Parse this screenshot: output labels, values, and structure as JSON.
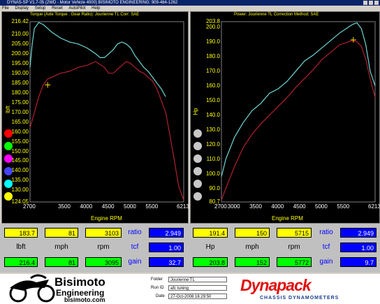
{
  "window": {
    "title": "DYNAS-SP V1.7-05  (2WD - Motor Vehicle 4000)  BISIMOTO ENGINEERING: 909-464-1262"
  },
  "menu": [
    "File",
    "Display",
    "Setup",
    "Reset",
    "AutoPilot",
    "Help"
  ],
  "left_chart": {
    "title": "Torque (Axle Torque : Gear Ratio): Jourienne TL     Corr: SAE",
    "y_unit": "lbft",
    "x_unit": "Engine RPM",
    "y_ticks": [
      "216.42",
      "210.00",
      "205.00",
      "200.00",
      "195.00",
      "190.00",
      "185.00",
      "180.00",
      "175.00",
      "170.00",
      "165.00",
      "160.00",
      "155.00",
      "150.00",
      "145.00",
      "140.00",
      "135.00",
      "130.00",
      "124.05"
    ],
    "x_ticks": [
      "2700",
      "3500",
      "4000",
      "4500",
      "5000",
      "5500",
      "6213"
    ]
  },
  "right_chart": {
    "title": "Power: Jourienne TL     Correction Method: SAE",
    "y_unit": "Hp",
    "x_unit": "Engine RPM",
    "y_ticks": [
      "203.8",
      "200.0",
      "190.0",
      "180.0",
      "170.0",
      "160.0",
      "150.0",
      "140.0",
      "130.0",
      "120.0",
      "110.0",
      "100.0",
      "90.0",
      "80.7"
    ],
    "x_ticks": [
      "2700",
      "3000",
      "3500",
      "4000",
      "4500",
      "5000",
      "5500",
      "6213"
    ]
  },
  "chart_data": [
    {
      "type": "line",
      "title": "Torque (Axle Torque : Gear Ratio): Jourienne TL     Corr: SAE",
      "xlabel": "Engine RPM",
      "ylabel": "lbft",
      "xlim": [
        2700,
        6213
      ],
      "ylim": [
        124.05,
        216.42
      ],
      "series": [
        {
          "color": "#6fd6d6",
          "x": [
            2700,
            2750,
            2800,
            2900,
            3000,
            3100,
            3200,
            3400,
            3600,
            3800,
            4000,
            4200,
            4300,
            4400,
            4500,
            4600,
            4700,
            4800,
            4900,
            5000,
            5100,
            5200,
            5300,
            5400,
            5500,
            5600,
            5700,
            5800
          ],
          "y": [
            193,
            205,
            213,
            216,
            215,
            213,
            211,
            208,
            206,
            205,
            203,
            200,
            198,
            198,
            200,
            202,
            205,
            206,
            205,
            203,
            199,
            196,
            193,
            191,
            188,
            185,
            182,
            178
          ]
        },
        {
          "color": "#b02030",
          "x": [
            2700,
            2800,
            2900,
            3000,
            3100,
            3200,
            3300,
            3400,
            3600,
            3800,
            4000,
            4200,
            4400,
            4500,
            4600,
            4700,
            4800,
            4900,
            5000,
            5100,
            5200,
            5300,
            5400,
            5500,
            5600,
            5700,
            5800,
            5900,
            6000,
            6100,
            6213
          ],
          "y": [
            162,
            170,
            178,
            184,
            187,
            188,
            189,
            190,
            191,
            193,
            194,
            196,
            193,
            190,
            190,
            192,
            194,
            196,
            195,
            193,
            191,
            190,
            188,
            186,
            182,
            176,
            170,
            158,
            145,
            132,
            125
          ]
        }
      ],
      "annotations": [
        "+ at 3103 rpm"
      ]
    },
    {
      "type": "line",
      "title": "Power: Jourienne TL     Correction Method: SAE",
      "xlabel": "Engine RPM",
      "ylabel": "Hp",
      "xlim": [
        2700,
        6213
      ],
      "ylim": [
        80.7,
        203.8
      ],
      "series": [
        {
          "color": "#6fd6d6",
          "x": [
            2700,
            2800,
            3000,
            3200,
            3400,
            3600,
            3800,
            4000,
            4200,
            4400,
            4600,
            4800,
            5000,
            5200,
            5400,
            5600,
            5700,
            5800,
            5900,
            6000,
            6100,
            6213
          ],
          "y": [
            98,
            110,
            125,
            135,
            143,
            148,
            155,
            158,
            163,
            170,
            177,
            181,
            186,
            191,
            196,
            200,
            202,
            203,
            199,
            188,
            170,
            160
          ]
        },
        {
          "color": "#b02030",
          "x": [
            2700,
            2800,
            3000,
            3200,
            3400,
            3600,
            3800,
            4000,
            4200,
            4400,
            4600,
            4800,
            5000,
            5200,
            5400,
            5600,
            5700,
            5800,
            5900,
            6000,
            6100,
            6213
          ],
          "y": [
            82,
            90,
            105,
            118,
            127,
            134,
            140,
            146,
            152,
            159,
            165,
            171,
            178,
            183,
            188,
            190,
            191,
            190,
            187,
            178,
            165,
            152
          ]
        }
      ],
      "annotations": [
        "+ at 5715 rpm"
      ]
    }
  ],
  "readouts": {
    "left": {
      "top": [
        "183.7",
        "81",
        "3103"
      ],
      "labels": [
        "lbft",
        "mph",
        "rpm"
      ],
      "bottom": [
        "216.4",
        "81",
        "3095"
      ],
      "side_labels": [
        "ratio",
        "tcf",
        "gain"
      ],
      "side_values": [
        "2.949",
        "1.00",
        "32.7"
      ]
    },
    "right": {
      "top": [
        "191.4",
        "150",
        "5715"
      ],
      "labels": [
        "Hp",
        "mph",
        "rpm"
      ],
      "bottom": [
        "203.8",
        "152",
        "5772"
      ],
      "side_labels": [
        "ratio",
        "tcf",
        "gain"
      ],
      "side_values": [
        "2.949",
        "1.00",
        "9.7"
      ]
    }
  },
  "footer": {
    "brand_left": "Bisimoto",
    "brand_left_sub": "Engineering",
    "brand_url": "bisimoto.com",
    "folder_label": "Folder",
    "folder_value": "Jourienne TL",
    "runid_label": "Run ID",
    "runid_value": "afc tuning",
    "date_label": "Date",
    "date_value": "27-Oct-2008   16:29:50",
    "brand_right": "Dynapack",
    "brand_right_sub": "CHASSIS DYNAMOMETERS"
  },
  "colors": {
    "accent_yellow": "#ffff00",
    "accent_green": "#00ff00",
    "accent_blue": "#0000ff",
    "series_cyan": "#6fd6d6",
    "series_red": "#b02030"
  },
  "left_dots": [
    "#ff0000",
    "#00ff00",
    "#ff00ff",
    "#4444ff",
    "#00ffff",
    "#ffff00"
  ]
}
